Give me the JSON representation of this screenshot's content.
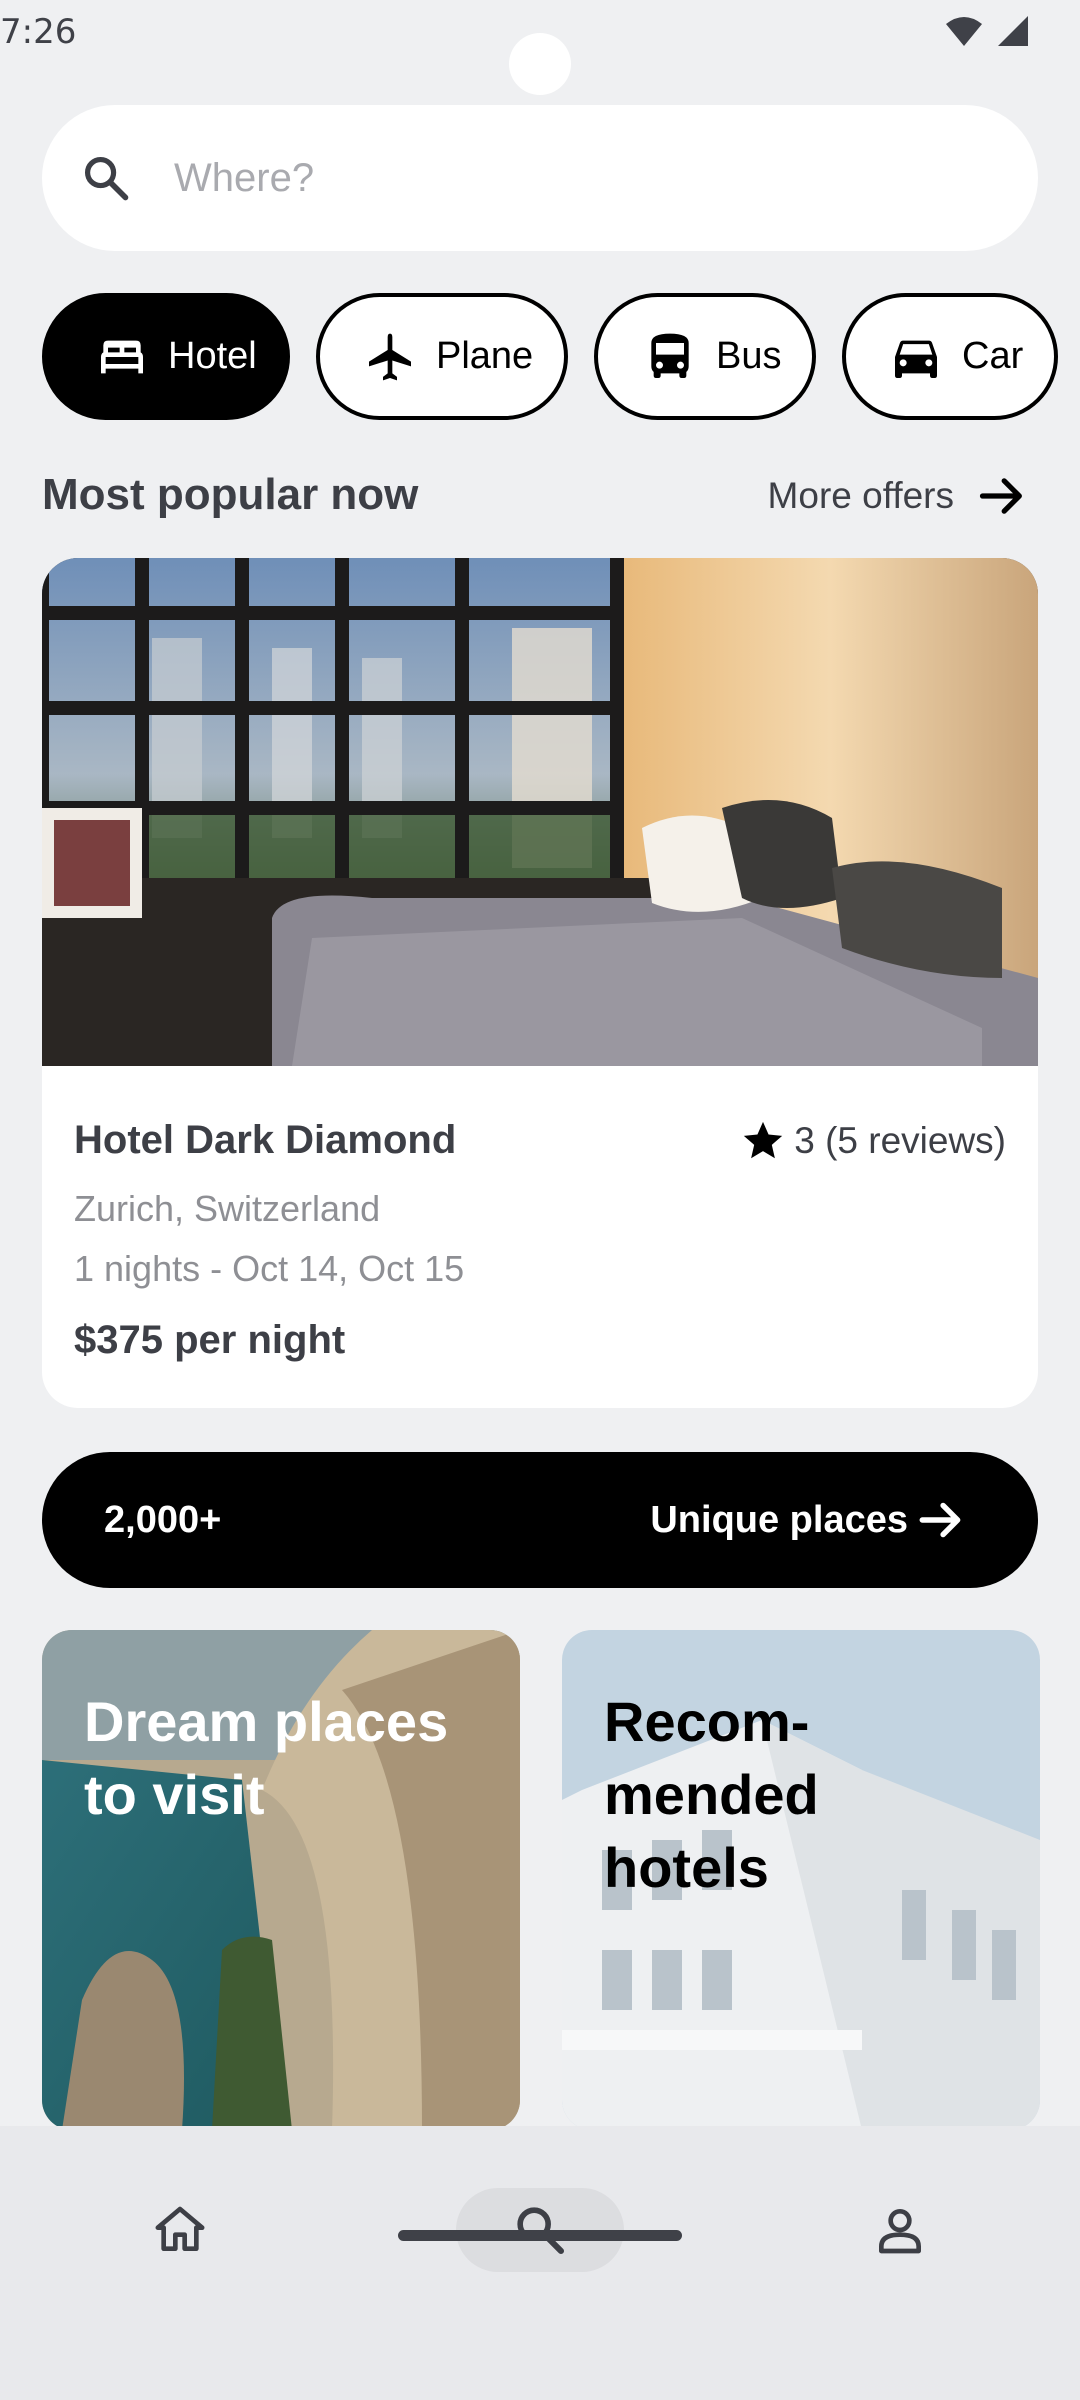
{
  "status_bar": {
    "time": "7:26",
    "wifi_icon": "wifi-icon",
    "signal_icon": "signal-icon"
  },
  "search": {
    "placeholder": "Where?",
    "value": "",
    "icon": "search-icon"
  },
  "categories": [
    {
      "label": "Hotel",
      "icon": "bed-icon",
      "active": true
    },
    {
      "label": "Plane",
      "icon": "plane-icon",
      "active": false
    },
    {
      "label": "Bus",
      "icon": "bus-icon",
      "active": false
    },
    {
      "label": "Car",
      "icon": "car-icon",
      "active": false
    }
  ],
  "popular": {
    "title": "Most popular now",
    "more_label": "More offers",
    "card": {
      "name": "Hotel Dark Diamond",
      "rating": "3 (5 reviews)",
      "location": "Zurich, Switzerland",
      "dates": "1 nights - Oct 14, Oct 15",
      "price": "$375 per night"
    }
  },
  "unique_banner": {
    "count": "2,000+",
    "label": "Unique places"
  },
  "promos": [
    {
      "title": "Dream places\nto visit"
    },
    {
      "title": "Recom-\nmended\nhotels"
    }
  ],
  "bottom_nav": [
    {
      "icon": "home-icon",
      "active": false
    },
    {
      "icon": "search-icon",
      "active": true
    },
    {
      "icon": "profile-icon",
      "active": false
    }
  ],
  "colors": {
    "background": "#eff0f2",
    "primary": "#000000",
    "surface": "#ffffff",
    "muted_text": "#8e8f94"
  }
}
